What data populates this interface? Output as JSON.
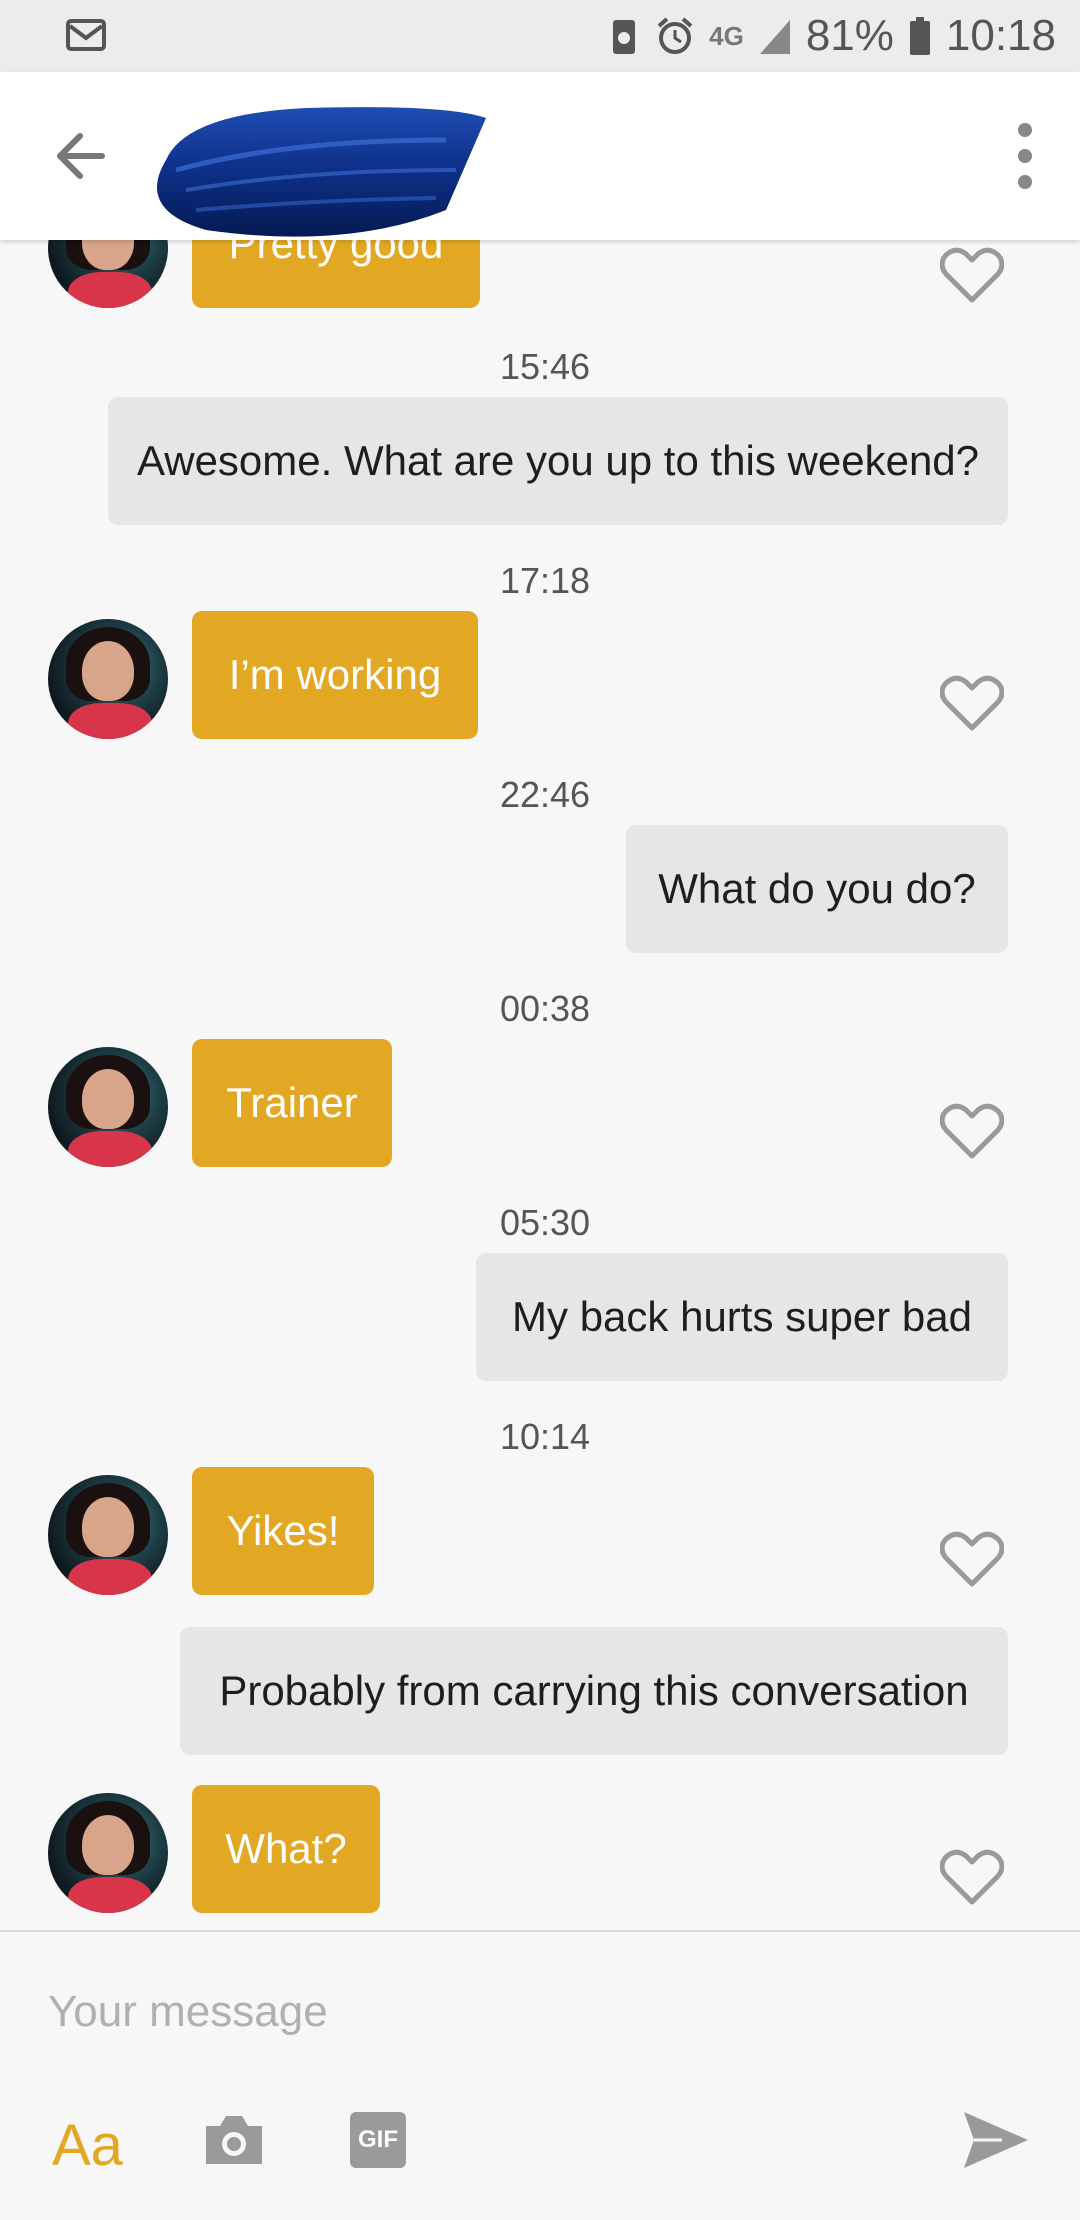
{
  "status_bar": {
    "battery": "81%",
    "time": "10:18",
    "network": "4G",
    "icons": [
      "mail-icon",
      "battery-saver-icon",
      "alarm-icon",
      "network-4g-icon",
      "signal-icon",
      "battery-icon"
    ]
  },
  "header": {
    "back_icon": "back-arrow-icon",
    "menu_icon": "overflow-menu-icon"
  },
  "timestamps": [
    "15:46",
    "17:18",
    "22:46",
    "00:38",
    "05:30",
    "10:14"
  ],
  "messages": [
    {
      "from": "them",
      "text": "Pretty good"
    },
    {
      "from": "me",
      "text": "Awesome. What are you up to this weekend?"
    },
    {
      "from": "them",
      "text": "I’m working"
    },
    {
      "from": "me",
      "text": "What do you do?"
    },
    {
      "from": "them",
      "text": "Trainer"
    },
    {
      "from": "me",
      "text": "My back hurts super bad"
    },
    {
      "from": "them",
      "text": "Yikes!"
    },
    {
      "from": "me",
      "text": "Probably from carrying this conversation"
    },
    {
      "from": "them",
      "text": "What?"
    }
  ],
  "composer": {
    "placeholder": "Your message",
    "format_label": "Aa",
    "gif_label": "GIF",
    "camera_icon": "camera-icon",
    "send_icon": "send-icon"
  },
  "colors": {
    "accent": "#e2a823",
    "incoming_bubble": "#e2a823",
    "outgoing_bubble": "#e6e6e6",
    "background": "#f7f7f7",
    "heart": "#9a9a9a"
  }
}
